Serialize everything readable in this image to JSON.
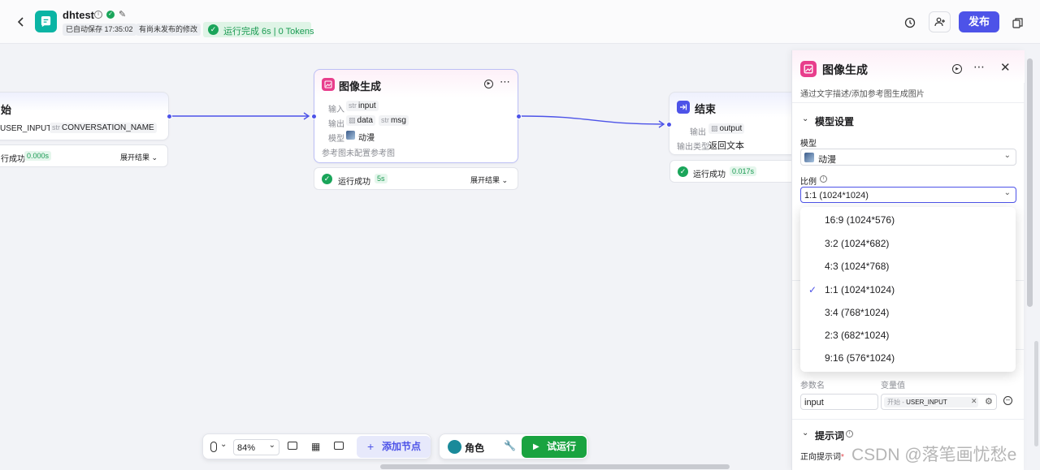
{
  "header": {
    "app_name": "dhtest",
    "autosave": "已自动保存 17:35:02",
    "unpublished": "有尚未发布的修改",
    "run_status": "运行完成 6s | 0 Tokens",
    "publish_label": "发布"
  },
  "nodes": {
    "start": {
      "title": "始",
      "var1": "USER_INPUT",
      "var2_type": "str",
      "var2": "CONVERSATION_NAME",
      "status": "行成功",
      "time": "0.000s",
      "expand": "展开结果"
    },
    "image": {
      "title": "图像生成",
      "input_label": "输入",
      "input_type": "str",
      "input_value": "input",
      "output_label": "输出",
      "output1": "data",
      "output2_type": "str",
      "output2": "msg",
      "model_label": "模型",
      "model_value": "动漫",
      "ref_label": "参考图",
      "ref_value": "未配置参考图",
      "status": "运行成功",
      "time": "5s",
      "expand": "展开结果"
    },
    "end": {
      "title": "结束",
      "output_label": "输出",
      "output_value": "output",
      "type_label": "输出类型",
      "type_value": "返回文本",
      "status": "运行成功",
      "time": "0.017s"
    }
  },
  "panel": {
    "title": "图像生成",
    "description": "通过文字描述/添加参考图生成图片",
    "section_model": "模型设置",
    "model_label": "模型",
    "model_value": "动漫",
    "ratio_label": "比例",
    "ratio_value": "1:1 (1024*1024)",
    "ratio_options": [
      "16:9 (1024*576)",
      "3:2 (1024*682)",
      "4:3 (1024*768)",
      "1:1 (1024*1024)",
      "3:4 (768*1024)",
      "2:3 (682*1024)",
      "9:16 (576*1024)"
    ],
    "selected_index": 3,
    "param_name_label": "参数名",
    "param_value_label": "变量值",
    "param_name": "input",
    "param_ref_prefix": "开始 -",
    "param_ref_value": "USER_INPUT",
    "section_prompt": "提示词",
    "positive_prompt_label": "正向提示词",
    "required_mark": "*"
  },
  "toolbar": {
    "zoom": "84%",
    "add_node": "添加节点",
    "role": "角色",
    "test_run": "试运行"
  },
  "watermark": "CSDN @落笔画忧愁e",
  "colors": {
    "accent": "#4d53e8",
    "success": "#1aa55a",
    "run_button": "#19a340",
    "node_icon": "#e83e8c"
  }
}
